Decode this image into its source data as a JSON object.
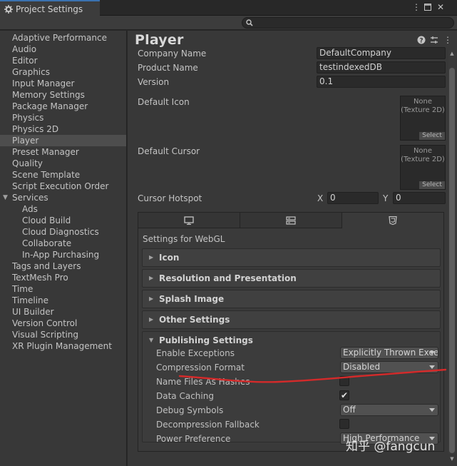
{
  "window": {
    "tab_title": "Project Settings"
  },
  "sidebar": {
    "items": [
      {
        "label": "Adaptive Performance"
      },
      {
        "label": "Audio"
      },
      {
        "label": "Editor"
      },
      {
        "label": "Graphics"
      },
      {
        "label": "Input Manager"
      },
      {
        "label": "Memory Settings"
      },
      {
        "label": "Package Manager"
      },
      {
        "label": "Physics"
      },
      {
        "label": "Physics 2D"
      },
      {
        "label": "Player"
      },
      {
        "label": "Preset Manager"
      },
      {
        "label": "Quality"
      },
      {
        "label": "Scene Template"
      },
      {
        "label": "Script Execution Order"
      },
      {
        "label": "Services"
      },
      {
        "label": "Ads"
      },
      {
        "label": "Cloud Build"
      },
      {
        "label": "Cloud Diagnostics"
      },
      {
        "label": "Collaborate"
      },
      {
        "label": "In-App Purchasing"
      },
      {
        "label": "Tags and Layers"
      },
      {
        "label": "TextMesh Pro"
      },
      {
        "label": "Time"
      },
      {
        "label": "Timeline"
      },
      {
        "label": "UI Builder"
      },
      {
        "label": "Version Control"
      },
      {
        "label": "Visual Scripting"
      },
      {
        "label": "XR Plugin Management"
      }
    ]
  },
  "player": {
    "title": "Player",
    "company_name_label": "Company Name",
    "company_name_value": "DefaultCompany",
    "product_name_label": "Product Name",
    "product_name_value": "testindexedDB",
    "version_label": "Version",
    "version_value": "0.1",
    "default_icon_label": "Default Icon",
    "default_cursor_label": "Default Cursor",
    "texture_none": "None",
    "texture_type": "(Texture 2D)",
    "select_label": "Select",
    "cursor_hotspot_label": "Cursor Hotspot",
    "hotspot_x_label": "X",
    "hotspot_x_value": "0",
    "hotspot_y_label": "Y",
    "hotspot_y_value": "0"
  },
  "platform": {
    "settings_for": "Settings for WebGL",
    "sections": {
      "icon": "Icon",
      "resolution": "Resolution and Presentation",
      "splash": "Splash Image",
      "other": "Other Settings",
      "publishing": "Publishing Settings"
    }
  },
  "publishing": {
    "enable_exceptions_label": "Enable Exceptions",
    "enable_exceptions_value": "Explicitly Thrown Exce",
    "compression_format_label": "Compression Format",
    "compression_format_value": "Disabled",
    "name_files_label": "Name Files As Hashes",
    "data_caching_label": "Data Caching",
    "data_caching_checked": "✔",
    "debug_symbols_label": "Debug Symbols",
    "debug_symbols_value": "Off",
    "decompression_fallback_label": "Decompression Fallback",
    "power_preference_label": "Power Preference",
    "power_preference_value": "High Performance"
  },
  "watermark": "知乎 @fangcun",
  "colors": {
    "accent": "#3a72b0",
    "annotation": "#d42a2a"
  },
  "icons": [
    "gear-icon",
    "menu-dots-icon",
    "maximize-icon",
    "close-icon",
    "search-icon",
    "help-icon",
    "preset-icon",
    "desktop-icon",
    "server-icon",
    "html5-icon"
  ]
}
